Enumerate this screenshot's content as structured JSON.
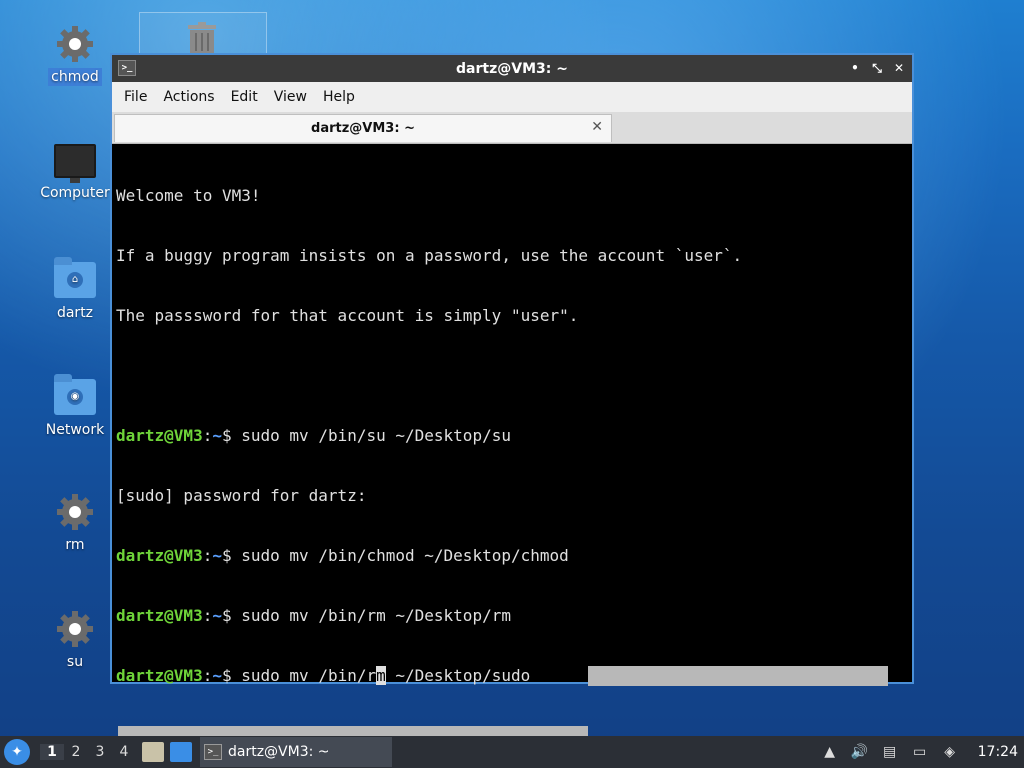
{
  "desktop": {
    "icons": [
      {
        "label": "chmod",
        "icon": "gear-icon"
      },
      {
        "label": "Computer",
        "icon": "monitor-icon"
      },
      {
        "label": "dartz",
        "icon": "home-folder-icon"
      },
      {
        "label": "Network",
        "icon": "network-folder-icon"
      },
      {
        "label": "rm",
        "icon": "gear-icon"
      },
      {
        "label": "su",
        "icon": "gear-icon"
      }
    ],
    "trash_icon": "trash-icon"
  },
  "window": {
    "title": "dartz@VM3: ~",
    "controls": {
      "minimize": "•",
      "maximize": "⤡",
      "close": "✕"
    },
    "menu": [
      "File",
      "Actions",
      "Edit",
      "View",
      "Help"
    ],
    "tab": {
      "label": "dartz@VM3: ~",
      "close": "✕"
    }
  },
  "terminal": {
    "lines": [
      "Welcome to VM3!",
      "If a buggy program insists on a password, use the account `user`.",
      "The passsword for that account is simply \"user\".",
      ""
    ],
    "prompt_user": "dartz@VM3",
    "prompt_colon": ":",
    "prompt_path": "~",
    "prompt_dollar": "$ ",
    "commands": [
      "sudo mv /bin/su ~/Desktop/su",
      "sudo mv /bin/chmod ~/Desktop/chmod",
      "sudo mv /bin/rm ~/Desktop/rm"
    ],
    "sudo_prompt": "[sudo] password for dartz:",
    "current_cmd_before": "sudo mv /bin/r",
    "current_cmd_cursor": "m",
    "current_cmd_after": " ~/Desktop/sudo"
  },
  "taskbar": {
    "workspaces": [
      "1",
      "2",
      "3",
      "4"
    ],
    "active_workspace": "1",
    "task_label": "dartz@VM3: ~",
    "clock": "17:24"
  },
  "colors": {
    "prompt_user": "#6fd43a",
    "prompt_path": "#5aa0ff",
    "window_border": "#4a90d9",
    "selection": "#b8b8b8"
  }
}
